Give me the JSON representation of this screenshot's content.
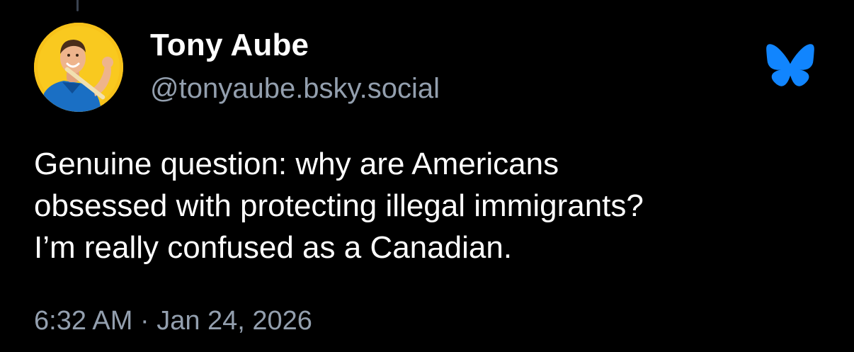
{
  "post": {
    "author": {
      "display_name": "Tony Aube",
      "handle": "@tonyaube.bsky.social",
      "avatar_icon": "profile-photo-avatar"
    },
    "logo_icon": "bluesky-butterfly-icon",
    "text_lines": [
      "Genuine question: why are Americans",
      "obsessed with protecting illegal immigrants?",
      "I’m really confused as a Canadian."
    ],
    "timestamp": "6:32 AM · Jan 24, 2026"
  },
  "colors": {
    "background": "#000000",
    "primary_text": "#ffffff",
    "secondary_text": "#939fae",
    "bluesky_blue": "#1185fe",
    "avatar_background": "#f7c21a"
  }
}
